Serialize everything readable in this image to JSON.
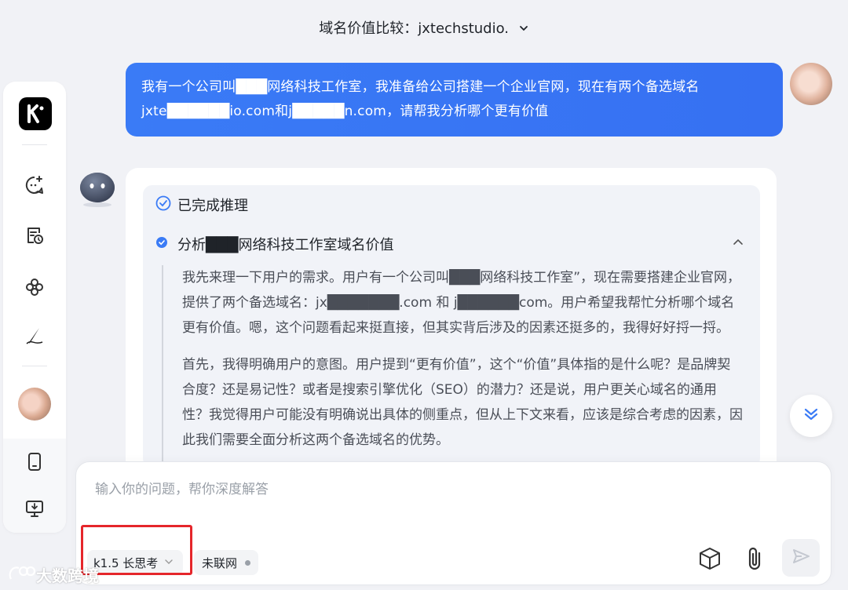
{
  "header": {
    "title": "域名价值比较：jxtechstudio."
  },
  "user_message": {
    "text": "我有一个公司叫███网络科技工作室，我准备给公司搭建一个企业官网，现在有两个备选域名jxte██████io.com和j█████n.com，请帮我分析哪个更有价值"
  },
  "assistant": {
    "reasoning_status": "已完成推理",
    "step_title": "分析███网络科技工作室域名价值",
    "paragraphs": [
      "我先来理一下用户的需求。用户有一个公司叫███网络科技工作室”，现在需要搭建企业官网，提供了两个备选域名：jx███████.com 和 j██████com。用户希望我帮忙分析哪个域名更有价值。嗯，这个问题看起来挺直接，但其实背后涉及的因素还挺多的，我得好好捋一捋。",
      "首先，我得明确用户的意图。用户提到“更有价值”，这个“价值”具体指的是什么呢？是品牌契合度？还是易记性？或者是搜索引擎优化（SEO）的潜力？还是说，用户更关心域名的通用性？我觉得用户可能没有明确说出具体的侧重点，但从上下文来看，应该是综合考虑的因素，因此我们需要全面分析这两个备选域名的优势。"
    ]
  },
  "composer": {
    "placeholder": "输入你的问题，帮你深度解答",
    "value": "",
    "model_label": "k1.5 长思考",
    "network_label": "未联网"
  },
  "watermark": {
    "text": "大数跨境"
  },
  "colors": {
    "accent": "#3a7bf6",
    "highlight": "#e5262b"
  }
}
